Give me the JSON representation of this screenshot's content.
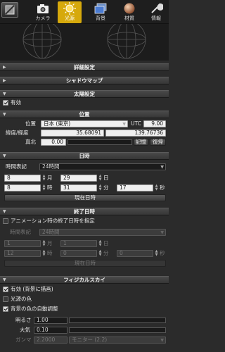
{
  "tabs": [
    {
      "label": "カメラ",
      "icon": "camera-icon"
    },
    {
      "label": "光源",
      "icon": "sun-icon",
      "active": true
    },
    {
      "label": "背景",
      "icon": "background-icon"
    },
    {
      "label": "材質",
      "icon": "material-sphere-icon"
    },
    {
      "label": "情報",
      "icon": "wrench-icon"
    }
  ],
  "sections": {
    "detail": "詳細設定",
    "shadow": "シャドウマップ",
    "sun": "太陽設定",
    "position": "位置",
    "datetime": "日時",
    "end": "終了日時",
    "sky": "フィジカルスカイ"
  },
  "sun": {
    "enabled_label": "有効"
  },
  "position": {
    "location_label": "位置",
    "location_value": "日本 (東京)",
    "utc_label": "UTC",
    "utc_value": "9.00",
    "latlon_label": "緯度/経度",
    "lat": "35.68091",
    "lon": "139.76736",
    "north_label": "真北",
    "north_value": "0.00",
    "memory_button": "記憶",
    "restore_button": "復帰"
  },
  "datetime": {
    "notation_label": "時間表記",
    "notation_value": "24時間",
    "month": "8",
    "month_unit": "月",
    "day": "29",
    "day_unit": "日",
    "hour": "8",
    "hour_unit": "時",
    "minute": "31",
    "minute_unit": "分",
    "second": "17",
    "second_unit": "秒",
    "now_button": "現在日時"
  },
  "end": {
    "check_label": "アニメーション時の終了日時を指定",
    "notation_label": "時間表記",
    "notation_value": "24時間",
    "month": "1",
    "month_unit": "月",
    "day": "1",
    "day_unit": "日",
    "hour": "12",
    "hour_unit": "時",
    "minute": "0",
    "minute_unit": "分",
    "second": "0",
    "second_unit": "秒",
    "now_button": "現在日時"
  },
  "sky": {
    "enabled_label": "有効 (背景に描画)",
    "light_color_label": "光源の色",
    "auto_color_label": "背景の色の自動調整",
    "brightness_label": "明るさ",
    "brightness_value": "1.00",
    "atmosphere_label": "大気",
    "atmosphere_value": "0.10",
    "gamma_label": "ガンマ",
    "gamma_value": "2.2000",
    "gamma_mode": "モニター (2.2)"
  }
}
